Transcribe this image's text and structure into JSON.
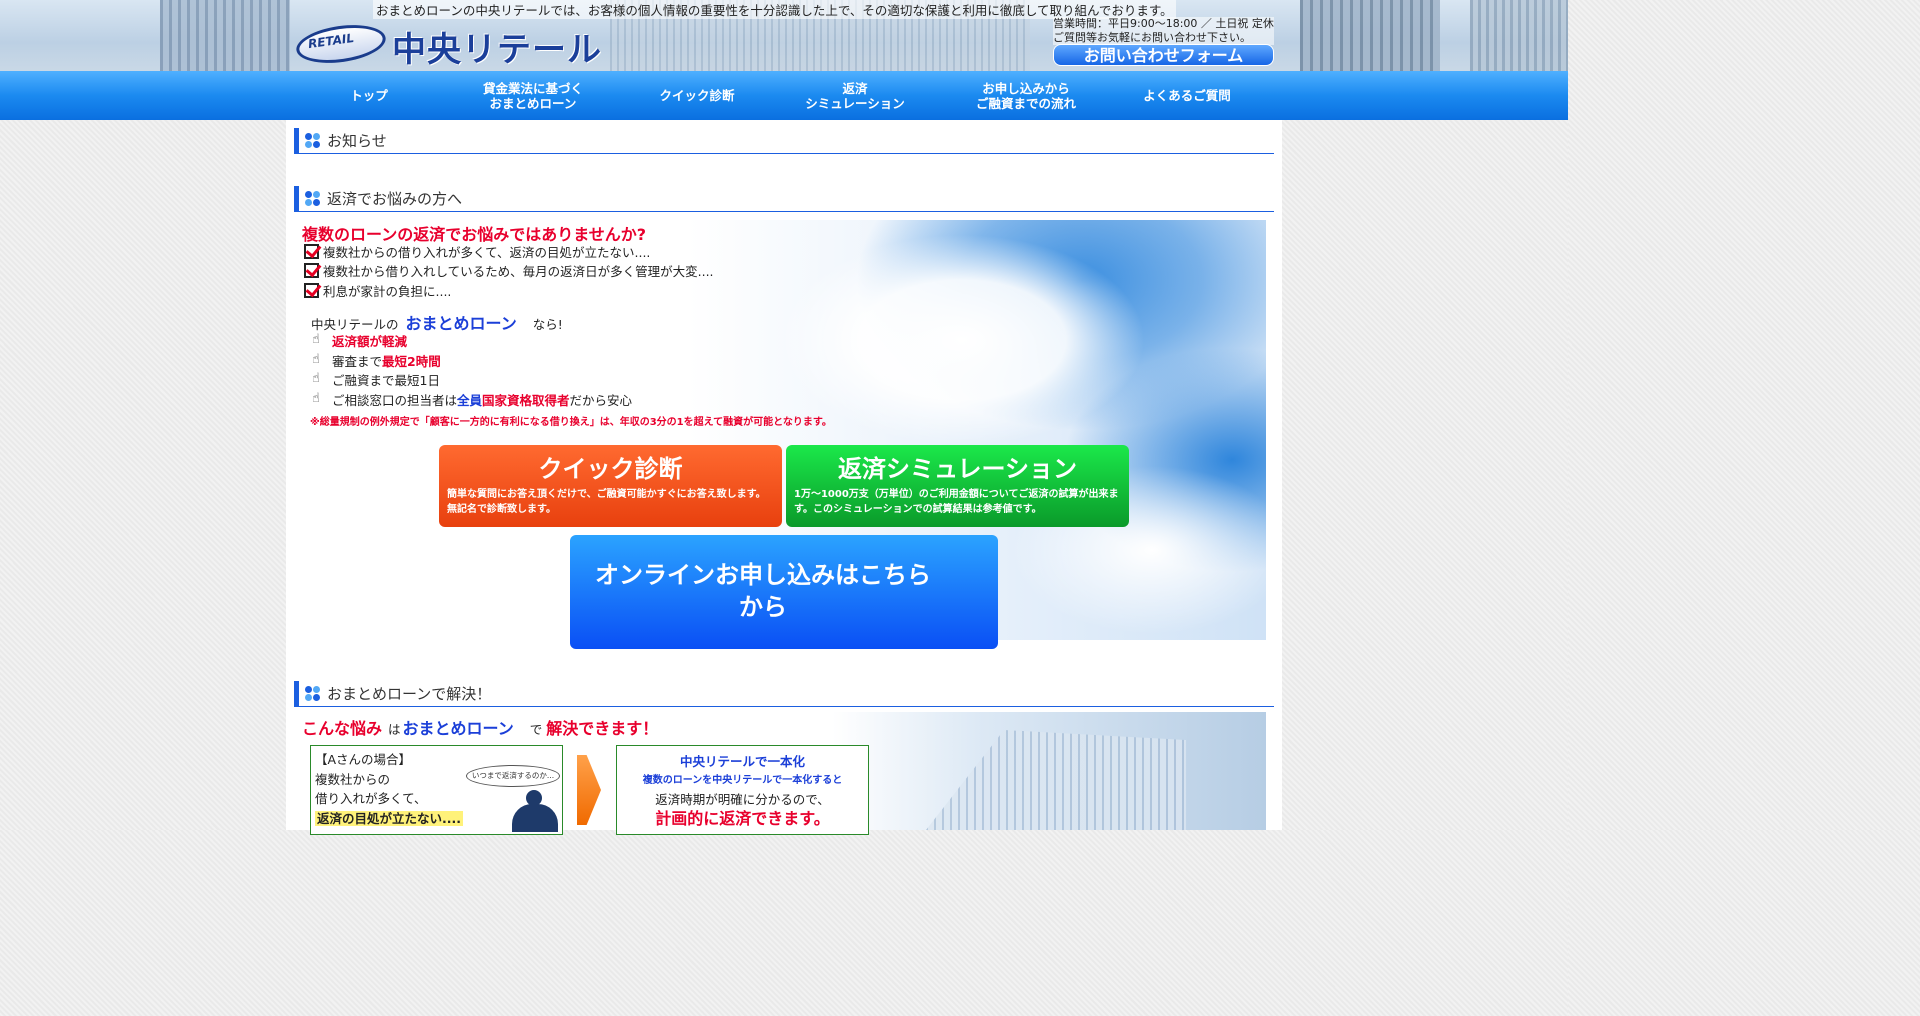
{
  "header": {
    "tagline": "おまとめローンの中央リテールでは、お客様の個人情報の重要性を十分認識した上で、その適切な保護と利用に徹底して取り組んでおります。",
    "logo_mark": "RETAIL",
    "logo_name": "中央リテール",
    "hours_line1": "営業時間：平日9:00～18:00 ／ 土日祝 定休",
    "hours_line2": "ご質問等お気軽にお問い合わせ下さい。",
    "contact_button": "お問い合わせフォーム"
  },
  "nav": {
    "items": [
      {
        "label": "トップ"
      },
      {
        "label": "貸金業法に基づく\nおまとめローン"
      },
      {
        "label": "クイック診断"
      },
      {
        "label": "返済\nシミュレーション"
      },
      {
        "label": "お申し込みから\nご融資までの流れ"
      },
      {
        "label": "よくあるご質問"
      }
    ]
  },
  "sections": {
    "news_title": "お知らせ",
    "worry_title": "返済でお悩みの方へ",
    "solve_title": "おまとめローンで解決！"
  },
  "worry": {
    "headline": "複数のローンの返済でお悩みではありませんか?",
    "checks": [
      "複数社からの借り入れが多くて、返済の目処が立たない....",
      "複数社から借り入れしているため、毎月の返済日が多く管理が大変....",
      "利息が家計の負担に...."
    ],
    "nara_prefix": "中央リテールの",
    "nara_product": "おまとめローン",
    "nara_suffix": "なら!",
    "merits": [
      {
        "a": "",
        "b": "返済額が軽減",
        "c": ""
      },
      {
        "a": "審査まで ",
        "b": "最短2時間",
        "c": ""
      },
      {
        "a": "ご融資まで最短1日",
        "b": "",
        "c": ""
      },
      {
        "a": "ご相談窓口の担当者は ",
        "b": "国家資格取得者",
        "c": "だから安心",
        "blue": "全員"
      }
    ],
    "note": "※総量規制の例外規定で「顧客に一方的に有利になる借り換え」は、年収の3分の1を超えて融資が可能となります。"
  },
  "cta": {
    "quick_title": "クイック診断",
    "quick_desc": "簡単な質問にお答え頂くだけで、ご融資可能かすぐにお答え致します。無記名で診断致します。",
    "sim_title": "返済シミュレーション",
    "sim_desc": "1万～1000万支（万単位）のご利用金額についてご返済の試算が出来ます。このシミュレーションでの試算結果は参考値です。",
    "apply_text": "オンラインお申し込みはこちらから"
  },
  "solve": {
    "s1": "こんな悩み",
    "s2": "は",
    "s3": "おまとめローン",
    "s4": "で",
    "s5": "解決できます！",
    "case_title": "【Aさんの場合】",
    "case_line1": "複数社からの",
    "case_line2": "借り入れが多くて、",
    "case_line3": "返済の目処が立たない....",
    "bubble": "いつまで返済するのか...",
    "result_title": "中央リテールで一本化",
    "result_sub": "複数のローンを中央リテールで一本化すると",
    "result_line": "返済時期が明確に分かるので、",
    "result_big": "計画的に返済できます。"
  },
  "colors": {
    "nav_blue": "#1b8af0",
    "accent_red": "#e8002d",
    "accent_blue": "#1b3fd8",
    "quick_orange": "#e8400e",
    "sim_green": "#0a9a2a",
    "apply_blue": "#0a4ff5"
  }
}
